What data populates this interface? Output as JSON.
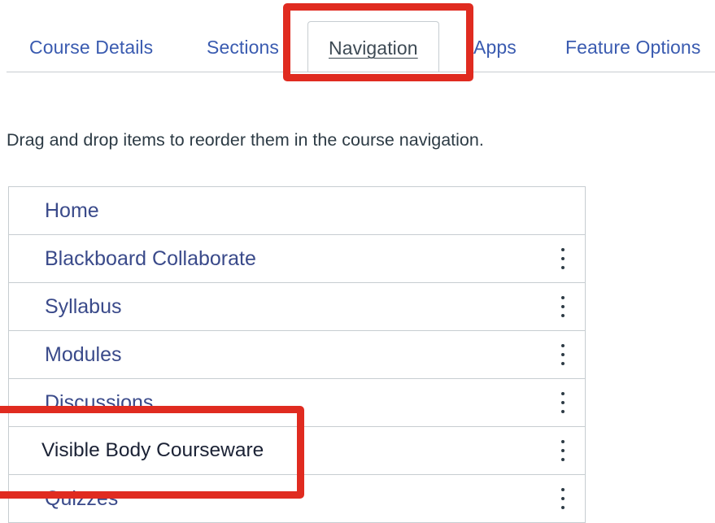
{
  "tabs": [
    {
      "label": "Course Details",
      "active": false
    },
    {
      "label": "Sections",
      "active": false
    },
    {
      "label": "Navigation",
      "active": true
    },
    {
      "label": "Apps",
      "active": false
    },
    {
      "label": "Feature Options",
      "active": false
    }
  ],
  "instructions": "Drag and drop items to reorder them in the course navigation.",
  "nav_items": [
    {
      "label": "Home",
      "has_menu": false
    },
    {
      "label": "Blackboard Collaborate",
      "has_menu": true
    },
    {
      "label": "Syllabus",
      "has_menu": true
    },
    {
      "label": "Modules",
      "has_menu": true
    },
    {
      "label": "Discussions",
      "has_menu": true
    },
    {
      "label": "Visible Body Courseware",
      "has_menu": true
    },
    {
      "label": "Quizzes",
      "has_menu": true
    }
  ],
  "icons": {
    "item_menu": "vertical-ellipsis-icon"
  },
  "colors": {
    "highlight": "#e02b20",
    "link": "#3a5bb0",
    "text": "#2d3b45",
    "border": "#c7cdd1"
  }
}
